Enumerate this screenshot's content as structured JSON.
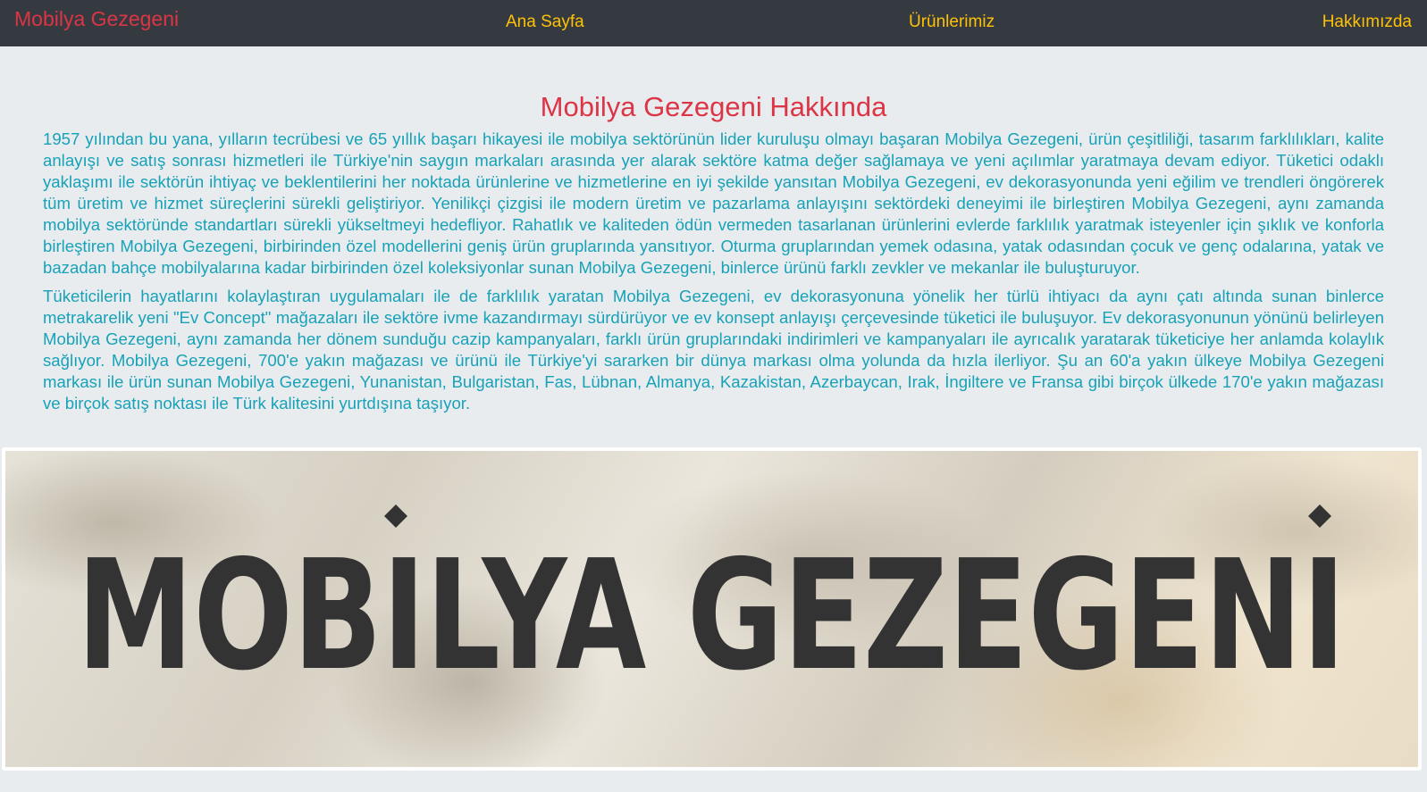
{
  "nav": {
    "brand": "Mobilya Gezegeni",
    "links": [
      "Ana Sayfa",
      "Ürünlerimiz",
      "Hakkımızda"
    ]
  },
  "main": {
    "title": "Mobilya Gezegeni Hakkında",
    "paragraphs": [
      "1957 yılından bu yana, yılların tecrübesi ve 65 yıllık başarı hikayesi ile mobilya sektörünün lider kuruluşu olmayı başaran Mobilya Gezegeni, ürün çeşitliliği, tasarım farklılıkları, kalite anlayışı ve satış sonrası hizmetleri ile Türkiye'nin saygın markaları arasında yer alarak sektöre katma değer sağlamaya ve yeni açılımlar yaratmaya devam ediyor. Tüketici odaklı yaklaşımı ile sektörün ihtiyaç ve beklentilerini her noktada ürünlerine ve hizmetlerine en iyi şekilde yansıtan Mobilya Gezegeni, ev dekorasyonunda yeni eğilim ve trendleri öngörerek tüm üretim ve hizmet süreçlerini sürekli geliştiriyor. Yenilikçi çizgisi ile modern üretim ve pazarlama anlayışını sektördeki deneyimi ile birleştiren Mobilya Gezegeni, aynı zamanda mobilya sektöründe standartları sürekli yükseltmeyi hedefliyor. Rahatlık ve kaliteden ödün vermeden tasarlanan ürünlerini evlerde farklılık yaratmak isteyenler için şıklık ve konforla birleştiren Mobilya Gezegeni, birbirinden özel modellerini geniş ürün gruplarında yansıtıyor. Oturma gruplarından yemek odasına, yatak odasından çocuk ve genç odalarına, yatak ve bazadan bahçe mobilyalarına kadar birbirinden özel koleksiyonlar sunan Mobilya Gezegeni, binlerce ürünü farklı zevkler ve mekanlar ile buluşturuyor.",
      "Tüketicilerin hayatlarını kolaylaştıran uygulamaları ile de farklılık yaratan Mobilya Gezegeni, ev dekorasyonuna yönelik her türlü ihtiyacı da aynı çatı altında sunan binlerce metrakarelik yeni \"Ev Concept\" mağazaları ile sektöre ivme kazandırmayı sürdürüyor ve ev konsept anlayışı çerçevesinde tüketici ile buluşuyor. Ev dekorasyonunun yönünü belirleyen Mobilya Gezegeni, aynı zamanda her dönem sunduğu cazip kampanyaları, farklı ürün gruplarındaki indirimleri ve kampanyaları ile ayrıcalık yaratarak tüketiciye her anlamda kolaylık sağlıyor. Mobilya Gezegeni, 700'e yakın mağazası ve ürünü ile Türkiye'yi sararken bir dünya markası olma yolunda da hızla ilerliyor. Şu an 60'a yakın ülkeye Mobilya Gezegeni markası ile ürün sunan Mobilya Gezegeni, Yunanistan, Bulgaristan, Fas, Lübnan, Almanya, Kazakistan, Azerbaycan, Irak, İngiltere ve Fransa gibi birçok ülkede 170'e yakın mağazası ve birçok satış noktası ile Türk kalitesini yurtdışına taşıyor."
    ]
  },
  "banner": {
    "logo_text": "MOBİLYA GEZEGENİ"
  },
  "colors": {
    "navbar_bg": "#343a40",
    "brand": "#dc3545",
    "nav_link": "#ffc107",
    "title": "#dc3545",
    "body_text": "#17a2b8",
    "page_bg": "#e9ecef",
    "logo_ink": "#333333"
  }
}
